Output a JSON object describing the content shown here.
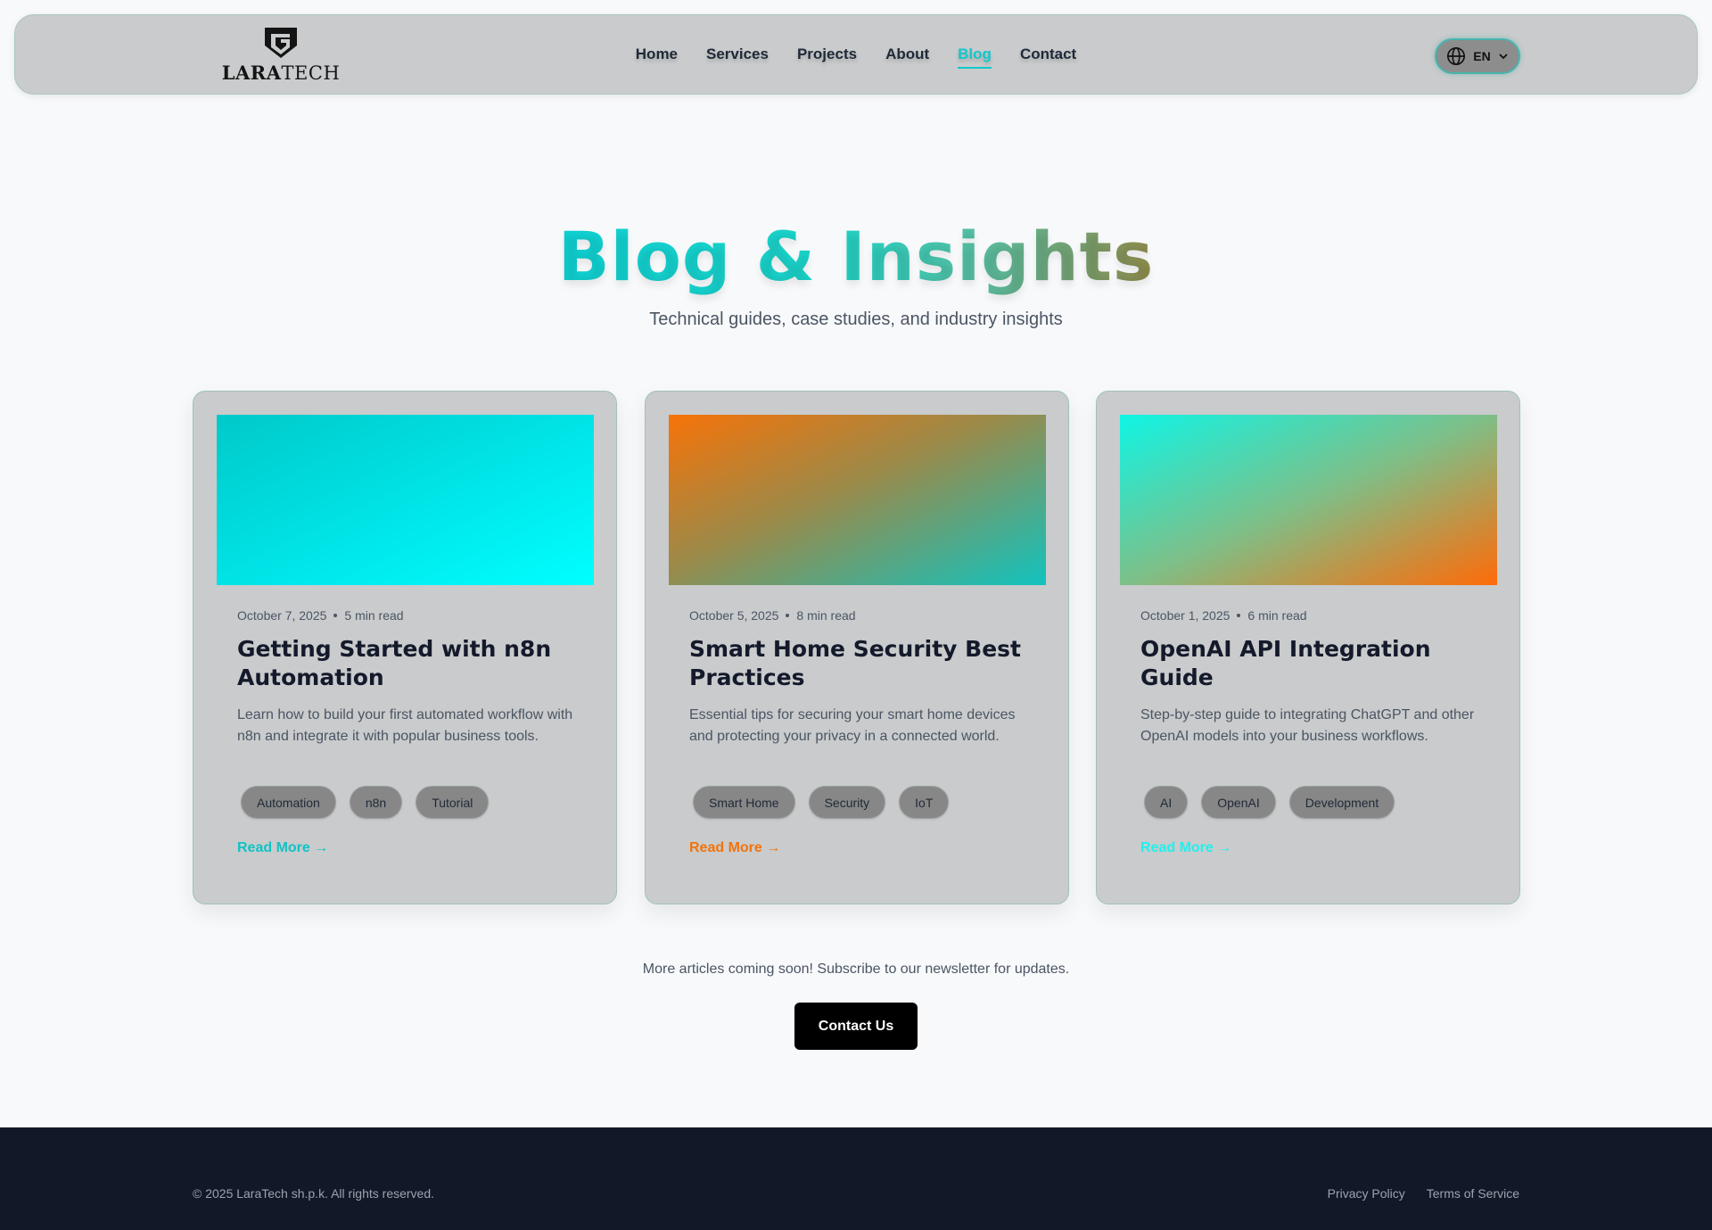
{
  "header": {
    "logo": {
      "bold": "LARA",
      "light": "TECH",
      "emblem_letter": "G"
    },
    "nav": [
      {
        "label": "Home",
        "active": false
      },
      {
        "label": "Services",
        "active": false
      },
      {
        "label": "Projects",
        "active": false
      },
      {
        "label": "About",
        "active": false
      },
      {
        "label": "Blog",
        "active": true
      },
      {
        "label": "Contact",
        "active": false
      }
    ],
    "language": {
      "code": "EN",
      "icon": "globe-icon",
      "chevron": "chevron-down-icon"
    }
  },
  "hero": {
    "title": "Blog & Insights",
    "subtitle": "Technical guides, case studies, and industry insights"
  },
  "posts": [
    {
      "date": "October 7, 2025",
      "read_time": "5 min read",
      "title": "Getting Started with n8n Automation",
      "description": "Learn how to build your first automated workflow with n8n and integrate it with popular business tools.",
      "tags": [
        "Automation",
        "n8n",
        "Tutorial"
      ],
      "read_more": "Read More →",
      "accent": "#10c3c6"
    },
    {
      "date": "October 5, 2025",
      "read_time": "8 min read",
      "title": "Smart Home Security Best Practices",
      "description": "Essential tips for securing your smart home devices and protecting your privacy in a connected world.",
      "tags": [
        "Smart Home",
        "Security",
        "IoT"
      ],
      "read_more": "Read More →",
      "accent": "#f2730d"
    },
    {
      "date": "October 1, 2025",
      "read_time": "6 min read",
      "title": "OpenAI API Integration Guide",
      "description": "Step-by-step guide to integrating ChatGPT and other OpenAI models into your business workflows.",
      "tags": [
        "AI",
        "OpenAI",
        "Development"
      ],
      "read_more": "Read More →",
      "accent": "#1ff1ee"
    }
  ],
  "cta": {
    "text": "More articles coming soon! Subscribe to our newsletter for updates.",
    "button": "Contact Us"
  },
  "footer": {
    "copyright": "© 2025 LaraTech sh.p.k. All rights reserved.",
    "links": [
      "Privacy Policy",
      "Terms of Service"
    ]
  },
  "colors": {
    "accent": "#10c8cc",
    "header_bg": "#c9cbcc",
    "card_bg": "#c9cbcc",
    "footer_bg": "#111827",
    "button_bg": "#000000"
  }
}
